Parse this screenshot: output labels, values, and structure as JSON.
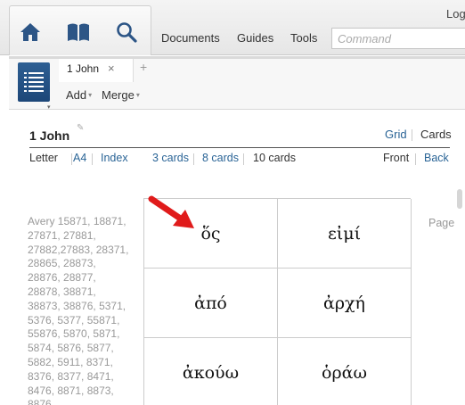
{
  "topbar": {
    "nav": [
      {
        "name": "home-icon"
      },
      {
        "name": "library-book-icon"
      },
      {
        "name": "search-icon"
      }
    ],
    "menu": [
      "Documents",
      "Guides",
      "Tools"
    ],
    "command_placeholder": "Command",
    "login_label": "Log"
  },
  "tabstrip": {
    "tab_label": "1 John",
    "close_glyph": "×",
    "add_glyph": "+",
    "add_label": "Add",
    "merge_label": "Merge",
    "caret": "▾"
  },
  "document": {
    "title": "1 John",
    "edit_glyph": "✎",
    "views": {
      "grid": "Grid",
      "cards": "Cards"
    },
    "paper": {
      "letter": "Letter",
      "a4": "A4",
      "index": "Index"
    },
    "counts": {
      "three": "3 cards",
      "eight": "8 cards",
      "ten": "10 cards"
    },
    "sides": {
      "front": "Front",
      "back": "Back"
    },
    "avery_text": "Avery 15871, 18871, 27871, 27881, 27882,27883, 28371, 28865, 28873, 28876, 28877, 28878, 38871, 38873, 38876, 5371, 5376, 5377, 55871, 55876, 5870, 5871, 5874, 5876, 5877, 5882, 5911, 8371, 8376, 8377, 8471, 8476, 8871, 8873, 8876,",
    "page_label": "Page"
  },
  "cards": [
    {
      "word": "ὅς"
    },
    {
      "word": "εἰμί"
    },
    {
      "word": "ἀπό"
    },
    {
      "word": "ἀρχή"
    },
    {
      "word": "ἀκούω"
    },
    {
      "word": "ὁράω"
    }
  ],
  "colors": {
    "link": "#2a6496",
    "panel_icon": "#2e5f93",
    "nav_icon": "#2c5586",
    "arrow": "#e01b1b"
  }
}
